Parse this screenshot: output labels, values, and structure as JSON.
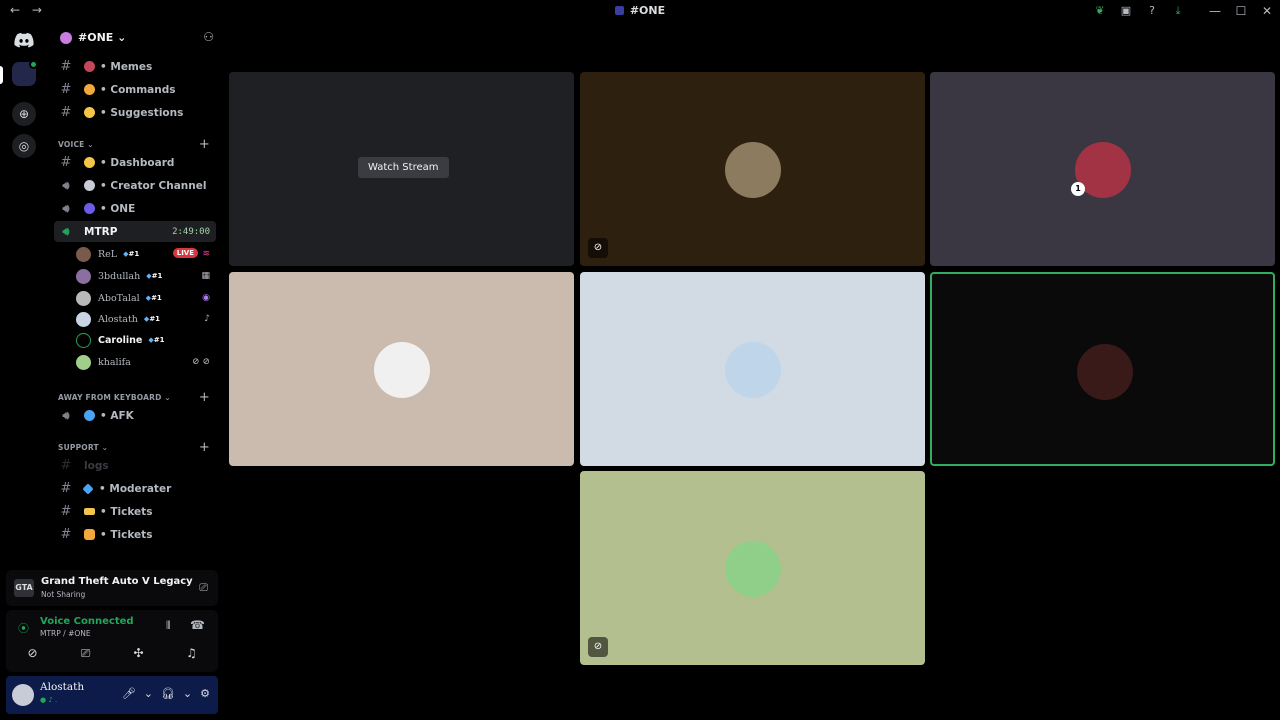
{
  "titlebar": {
    "back": "←",
    "forward": "→",
    "title": "#ONE",
    "min": "—",
    "max": "☐",
    "close": "✕"
  },
  "guild": {
    "name": "#ONE ⌄"
  },
  "channels_top": [
    {
      "name": "• Memes",
      "emoji_color": "#c2485a"
    },
    {
      "name": "• Commands",
      "emoji_color": "#f2a83b"
    },
    {
      "name": "• Suggestions",
      "emoji_color": "#f4c54a"
    }
  ],
  "categories": {
    "voice": "VOICE ⌄",
    "afk": "AWAY FROM KEYBOARD ⌄",
    "support": "SUPPORT ⌄",
    "plus": "+"
  },
  "voice_channels": [
    {
      "name": "• Dashboard",
      "type": "text",
      "emoji_color": "#f4c54a"
    },
    {
      "name": "•  Creator Channel",
      "type": "voice",
      "emoji_color": "#c7ccd6"
    },
    {
      "name": "• ONE",
      "type": "voice",
      "emoji_color": "#6c5ce7"
    }
  ],
  "active_channel": {
    "name": "MTRP",
    "timer": "2:49:00"
  },
  "members": [
    {
      "name": "ReL",
      "badge": "#1",
      "live": "LIVE",
      "tail": "≋"
    },
    {
      "name": "3bdullah",
      "badge": "#1",
      "tail": "▦"
    },
    {
      "name": "AboTalal",
      "badge": "#1",
      "tail": "◉"
    },
    {
      "name": "Alostath",
      "badge": "#1",
      "tail": "♪"
    },
    {
      "name": "Caroline",
      "badge": "#1",
      "tail": ""
    },
    {
      "name": "khalifa",
      "badge": "",
      "tail": "⊘ ⊘"
    }
  ],
  "afk_channel": {
    "name": "• AFK"
  },
  "support_channels": [
    {
      "name": "logs",
      "dim": true
    },
    {
      "name": "• Moderater",
      "emoji_color": "#4aa3f4"
    },
    {
      "name": "• Tickets",
      "emoji_color": "#f4c54a"
    },
    {
      "name": "• Tickets",
      "emoji_color": "#f4a83b"
    }
  ],
  "activity": {
    "game": "Grand Theft Auto V Legacy",
    "status": "Not Sharing",
    "icon": "GTA"
  },
  "voice": {
    "status": "Voice Connected",
    "location": "MTRP / #ONE"
  },
  "user": {
    "name": "Alostath",
    "sub": "● ♪ ."
  },
  "stream": {
    "watch_label": "Watch Stream"
  },
  "tiles": [
    {
      "avatar_color": "#55463a"
    },
    {
      "avatar_color": "#8c7b5e"
    },
    {
      "avatar_color": "#a13345"
    },
    {
      "avatar_color": "#f0f0f0"
    },
    {
      "avatar_color": "#bfd6ea"
    },
    {
      "avatar_color": "#3a1919"
    },
    {
      "avatar_color": "#8fcf8a"
    }
  ],
  "tile3_number": "1"
}
